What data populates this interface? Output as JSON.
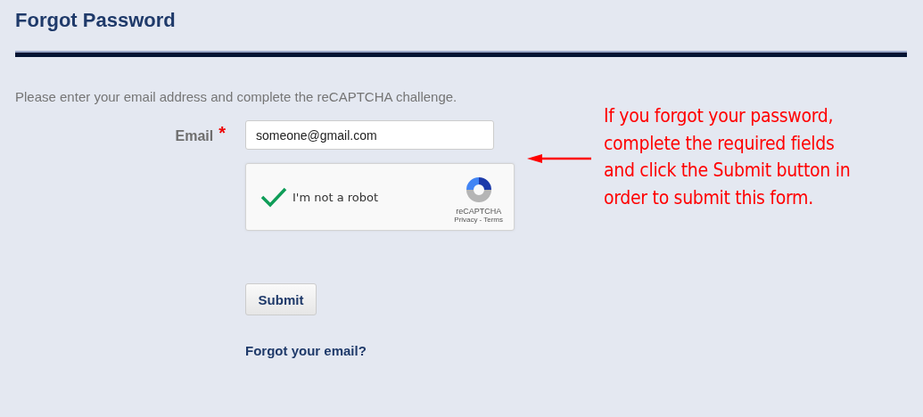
{
  "title": "Forgot Password",
  "instructions": "Please enter your email address and complete the reCAPTCHA challenge.",
  "email": {
    "label": "Email",
    "required_mark": "*",
    "value": "someone@gmail.com"
  },
  "captcha": {
    "label": "I'm not a robot",
    "checked": true,
    "brand": "reCAPTCHA",
    "privacy": "Privacy",
    "separator": "-",
    "terms": "Terms"
  },
  "submit_button": "Submit",
  "forgot_email_link": "Forgot your email?",
  "annotation": {
    "lines": [
      "If you forgot your password,",
      "complete the required fields",
      "and click the Submit button in",
      "order to submit this form."
    ]
  }
}
